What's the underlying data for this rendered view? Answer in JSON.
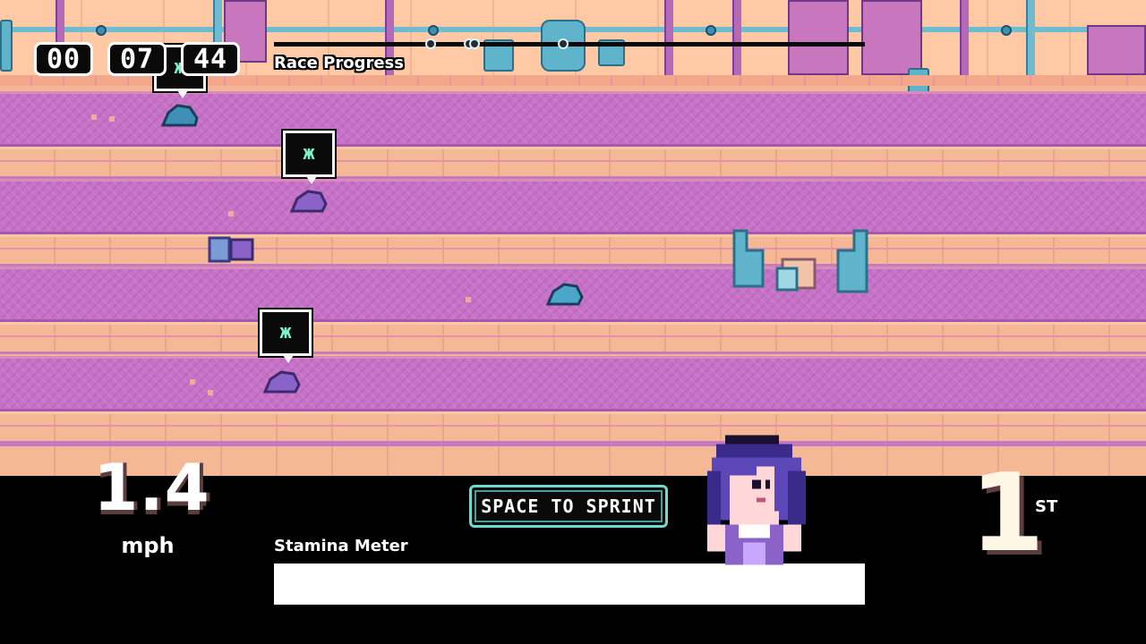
{
  "hud": {
    "timer": {
      "minutes": "00",
      "seconds": "07",
      "hundredths": "44"
    },
    "race_progress_label": "Race Progress",
    "race_progress_markers": [
      0.265,
      0.33,
      0.34,
      0.49
    ],
    "speed_value": "1.4",
    "speed_unit": "mph",
    "sprint_prompt": "SPACE TO SPRINT",
    "stamina_label": "Stamina Meter",
    "stamina_level": 1.0,
    "place_number": "1",
    "place_suffix": "ST"
  },
  "opponents": [
    {
      "emote": "ж"
    },
    {
      "emote": "ж"
    },
    {
      "emote": "ж"
    }
  ],
  "colors": {
    "lane": "#c672c6",
    "floor": "#f2b595",
    "player_hair": "#5b47b8",
    "accent_cyan": "#6fd8d0"
  }
}
